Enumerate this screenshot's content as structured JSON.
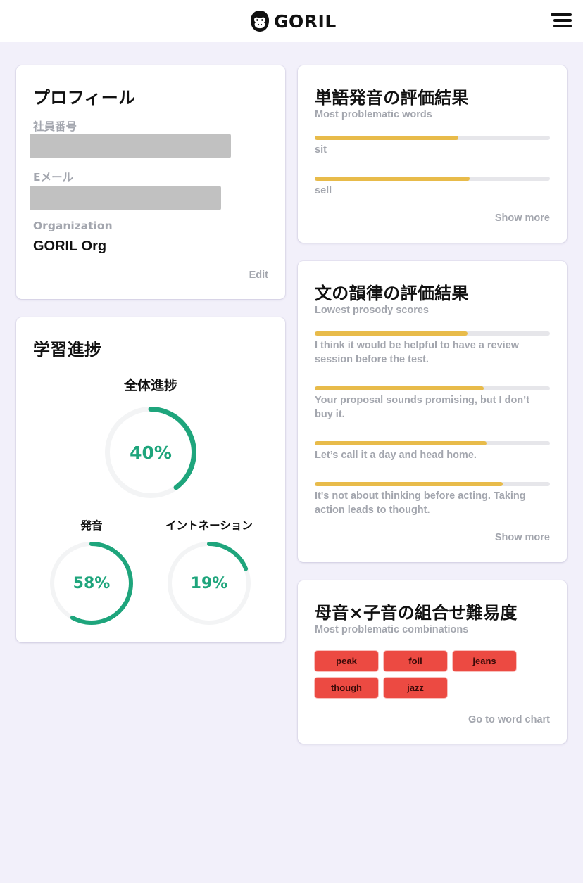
{
  "header": {
    "brand": "GORIL",
    "logo_icon": "gorilla-icon",
    "menu_icon": "hamburger-menu-icon"
  },
  "profile": {
    "title": "プロフィール",
    "employee_id_label": "社員番号",
    "email_label": "Eメール",
    "organization_label": "Organization",
    "organization_value": "GORIL Org",
    "edit_label": "Edit"
  },
  "progress": {
    "title": "学習進捗",
    "overall": {
      "label": "全体進捗",
      "value_text": "40%",
      "percent": 40
    },
    "pronunciation": {
      "label": "発音",
      "value_text": "58%",
      "percent": 58
    },
    "intonation": {
      "label": "イントネーション",
      "value_text": "19%",
      "percent": 19
    }
  },
  "word_results": {
    "title": "単語発音の評価結果",
    "subtitle": "Most problematic words",
    "items": [
      {
        "label": "sit",
        "score_percent": 61
      },
      {
        "label": "sell",
        "score_percent": 66
      }
    ],
    "show_more_label": "Show more"
  },
  "prosody_results": {
    "title": "文の韻律の評価結果",
    "subtitle": "Lowest prosody scores",
    "items": [
      {
        "label": "I think it would be helpful to have a review session before the test.",
        "score_percent": 65
      },
      {
        "label": "Your proposal sounds promising, but I don’t buy it.",
        "score_percent": 72
      },
      {
        "label": "Let’s call it a day and head home.",
        "score_percent": 73
      },
      {
        "label": "It's not about thinking before acting. Taking action leads to thought.",
        "score_percent": 80
      }
    ],
    "show_more_label": "Show more"
  },
  "combinations": {
    "title": "母音×子音の組合せ難易度",
    "subtitle": "Most problematic combinations",
    "chips": [
      "peak",
      "foil",
      "jeans",
      "though",
      "jazz"
    ],
    "link_label": "Go to word chart"
  },
  "colors": {
    "accent_green": "#1ea57c",
    "bar_yellow": "#e8bb4a",
    "chip_red": "#ec4a42",
    "background": "#f2f0fa"
  }
}
